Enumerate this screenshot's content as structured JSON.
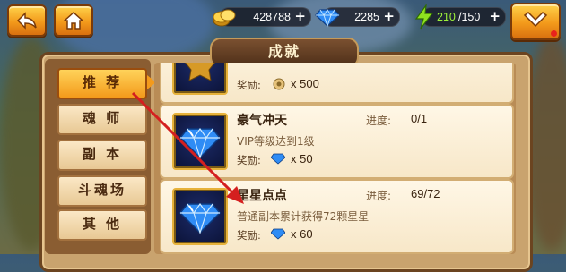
{
  "header": {
    "gold": "428788",
    "diamonds": "2285",
    "energy_current": "210",
    "energy_max": "/150",
    "plus": "+"
  },
  "panel": {
    "title": "成就"
  },
  "tabs": [
    {
      "label": "推 荐",
      "active": true
    },
    {
      "label": "魂 师",
      "active": false
    },
    {
      "label": "副 本",
      "active": false
    },
    {
      "label": "斗魂场",
      "active": false
    },
    {
      "label": "其 他",
      "active": false
    }
  ],
  "achievements": [
    {
      "title": "",
      "desc": "",
      "reward_label": "奖励:",
      "reward_icon": "gear-coin-icon",
      "reward_amount": "x 500",
      "progress_label": "",
      "progress": ""
    },
    {
      "title": "豪气冲天",
      "desc": "VIP等级达到1级",
      "reward_label": "奖励:",
      "reward_icon": "diamond-icon",
      "reward_amount": "x 50",
      "progress_label": "进度:",
      "progress": "0/1"
    },
    {
      "title": "星星点点",
      "desc": "普通副本累计获得72颗星星",
      "reward_label": "奖励:",
      "reward_icon": "diamond-icon",
      "reward_amount": "x 60",
      "progress_label": "进度:",
      "progress": "69/72"
    }
  ],
  "colors": {
    "accent_orange": "#f39a1b",
    "arrow_red": "#d41f1f",
    "diamond_blue": "#2f8cf5",
    "energy_green": "#8fe21f"
  }
}
